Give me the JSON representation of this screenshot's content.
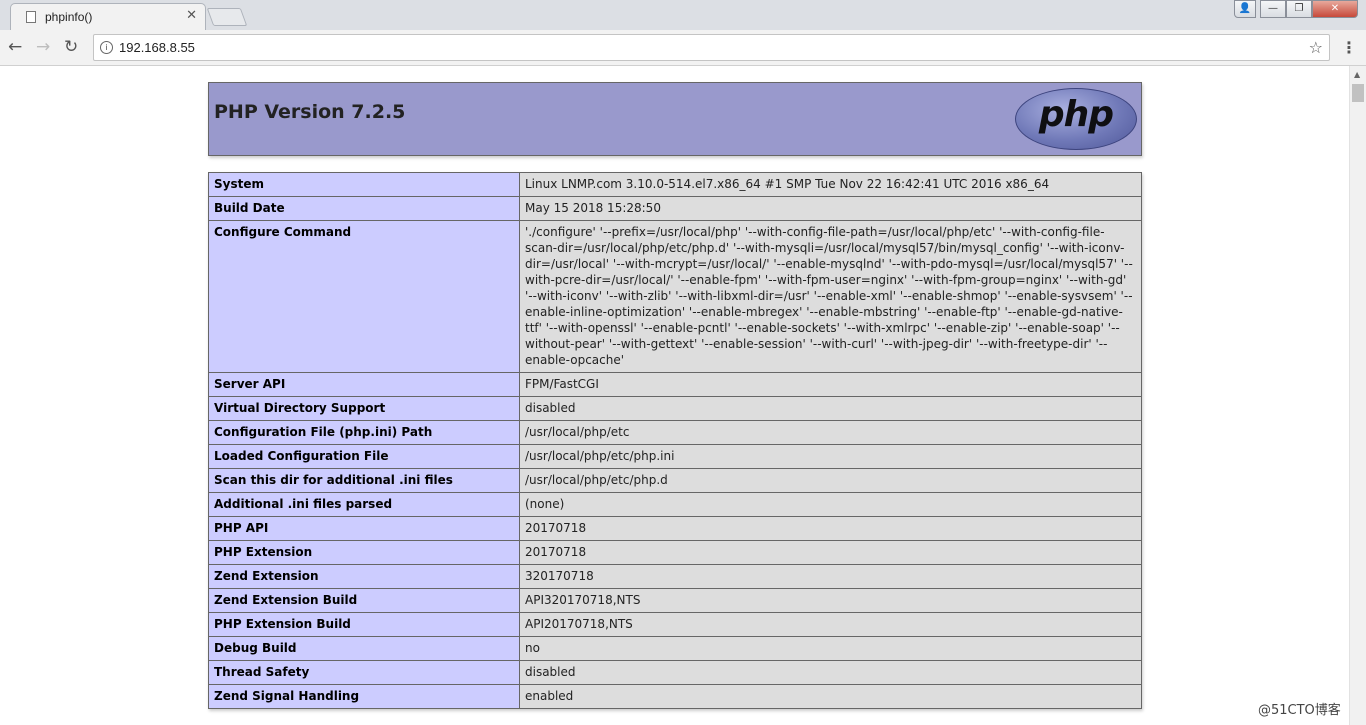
{
  "browser": {
    "tab_title": "phpinfo()",
    "tab_close": "✕",
    "url": "192.168.8.55",
    "icons": [
      "back-arrow-icon",
      "forward-arrow-icon",
      "reload-icon",
      "info-icon",
      "star-icon",
      "menu-icon"
    ]
  },
  "window_controls": {
    "user": "👤",
    "minimize": "—",
    "maximize": "❐",
    "close": "✕"
  },
  "page": {
    "version_title": "PHP Version 7.2.5",
    "logo_text": "php",
    "rows": [
      {
        "key": "System",
        "value": "Linux LNMP.com 3.10.0-514.el7.x86_64 #1 SMP Tue Nov 22 16:42:41 UTC 2016 x86_64"
      },
      {
        "key": "Build Date",
        "value": "May 15 2018 15:28:50"
      },
      {
        "key": "Configure Command",
        "value": "'./configure' '--prefix=/usr/local/php' '--with-config-file-path=/usr/local/php/etc' '--with-config-file-scan-dir=/usr/local/php/etc/php.d' '--with-mysqli=/usr/local/mysql57/bin/mysql_config' '--with-iconv-dir=/usr/local' '--with-mcrypt=/usr/local/' '--enable-mysqlnd' '--with-pdo-mysql=/usr/local/mysql57' '--with-pcre-dir=/usr/local/' '--enable-fpm' '--with-fpm-user=nginx' '--with-fpm-group=nginx' '--with-gd' '--with-iconv' '--with-zlib' '--with-libxml-dir=/usr' '--enable-xml' '--enable-shmop' '--enable-sysvsem' '--enable-inline-optimization' '--enable-mbregex' '--enable-mbstring' '--enable-ftp' '--enable-gd-native-ttf' '--with-openssl' '--enable-pcntl' '--enable-sockets' '--with-xmlrpc' '--enable-zip' '--enable-soap' '--without-pear' '--with-gettext' '--enable-session' '--with-curl' '--with-jpeg-dir' '--with-freetype-dir' '--enable-opcache'"
      },
      {
        "key": "Server API",
        "value": "FPM/FastCGI"
      },
      {
        "key": "Virtual Directory Support",
        "value": "disabled"
      },
      {
        "key": "Configuration File (php.ini) Path",
        "value": "/usr/local/php/etc"
      },
      {
        "key": "Loaded Configuration File",
        "value": "/usr/local/php/etc/php.ini"
      },
      {
        "key": "Scan this dir for additional .ini files",
        "value": "/usr/local/php/etc/php.d"
      },
      {
        "key": "Additional .ini files parsed",
        "value": "(none)"
      },
      {
        "key": "PHP API",
        "value": "20170718"
      },
      {
        "key": "PHP Extension",
        "value": "20170718"
      },
      {
        "key": "Zend Extension",
        "value": "320170718"
      },
      {
        "key": "Zend Extension Build",
        "value": "API320170718,NTS"
      },
      {
        "key": "PHP Extension Build",
        "value": "API20170718,NTS"
      },
      {
        "key": "Debug Build",
        "value": "no"
      },
      {
        "key": "Thread Safety",
        "value": "disabled"
      },
      {
        "key": "Zend Signal Handling",
        "value": "enabled"
      }
    ]
  },
  "watermark": "@51CTO博客"
}
